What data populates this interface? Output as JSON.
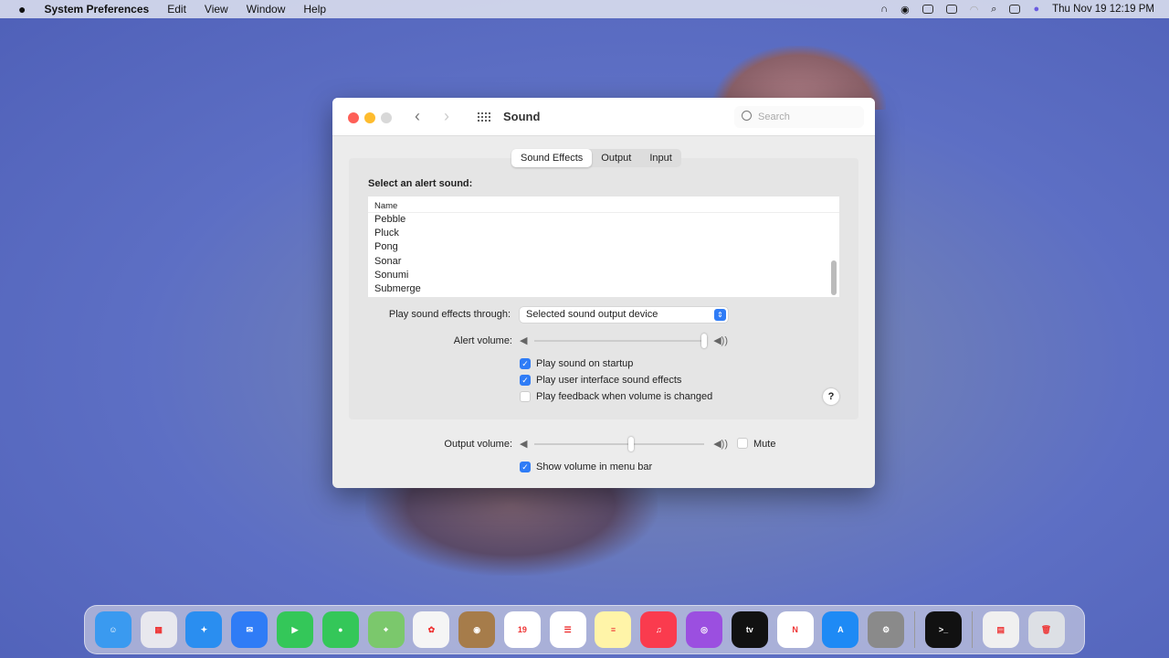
{
  "menubar": {
    "app": "System Preferences",
    "items": [
      "Edit",
      "View",
      "Window",
      "Help"
    ],
    "clock": "Thu Nov 19  12:19 PM",
    "status_icons": [
      "headphones-icon",
      "user-icon",
      "display-icon",
      "window-icon",
      "wifi-icon",
      "search-icon",
      "control-center-icon",
      "siri-icon"
    ]
  },
  "window": {
    "title": "Sound",
    "search_placeholder": "Search",
    "tabs": [
      {
        "label": "Sound Effects",
        "selected": true
      },
      {
        "label": "Output",
        "selected": false
      },
      {
        "label": "Input",
        "selected": false
      }
    ],
    "alert_heading": "Select an alert sound:",
    "list": {
      "column": "Name",
      "rows": [
        "Pebble",
        "Pluck",
        "Pong",
        "Sonar",
        "Sonumi",
        "Submerge"
      ]
    },
    "play_through_label": "Play sound effects through:",
    "play_through_value": "Selected sound output device",
    "alert_volume_label": "Alert volume:",
    "alert_volume": 100,
    "checkboxes": [
      {
        "label": "Play sound on startup",
        "checked": true
      },
      {
        "label": "Play user interface sound effects",
        "checked": true
      },
      {
        "label": "Play feedback when volume is changed",
        "checked": false
      }
    ],
    "help": "?",
    "output_volume_label": "Output volume:",
    "output_volume": 57,
    "mute_label": "Mute",
    "mute": false,
    "show_volume_label": "Show volume in menu bar",
    "show_volume": true
  },
  "dock": {
    "apps": [
      {
        "name": "Finder",
        "color": "#3a9af0",
        "glyph": "☺"
      },
      {
        "name": "Launchpad",
        "color": "#e8e8ee",
        "glyph": "▦"
      },
      {
        "name": "Safari",
        "color": "#2a8ef0",
        "glyph": "✦"
      },
      {
        "name": "Mail",
        "color": "#2f7cf6",
        "glyph": "✉"
      },
      {
        "name": "FaceTime",
        "color": "#34c759",
        "glyph": "▶"
      },
      {
        "name": "Messages",
        "color": "#34c759",
        "glyph": "●"
      },
      {
        "name": "Maps",
        "color": "#7bc86c",
        "glyph": "⌖"
      },
      {
        "name": "Photos",
        "color": "#f5f5f5",
        "glyph": "✿"
      },
      {
        "name": "Contacts",
        "color": "#a67c4a",
        "glyph": "◉"
      },
      {
        "name": "Calendar",
        "color": "#ffffff",
        "glyph": "19"
      },
      {
        "name": "Reminders",
        "color": "#ffffff",
        "glyph": "☰"
      },
      {
        "name": "Notes",
        "color": "#fff4a8",
        "glyph": "≡"
      },
      {
        "name": "Music",
        "color": "#fa3b4e",
        "glyph": "♫"
      },
      {
        "name": "Podcasts",
        "color": "#9b4fe0",
        "glyph": "◎"
      },
      {
        "name": "TV",
        "color": "#111111",
        "glyph": "tv"
      },
      {
        "name": "News",
        "color": "#ffffff",
        "glyph": "N"
      },
      {
        "name": "App Store",
        "color": "#1e8af5",
        "glyph": "A"
      },
      {
        "name": "System Preferences",
        "color": "#8a8a8a",
        "glyph": "⚙"
      }
    ],
    "others": [
      {
        "name": "Terminal",
        "color": "#111111",
        "glyph": ">_"
      },
      {
        "name": "Document",
        "color": "#f0f0f0",
        "glyph": "▤"
      },
      {
        "name": "Trash",
        "color": "#dde0e5",
        "glyph": "🗑"
      }
    ]
  }
}
